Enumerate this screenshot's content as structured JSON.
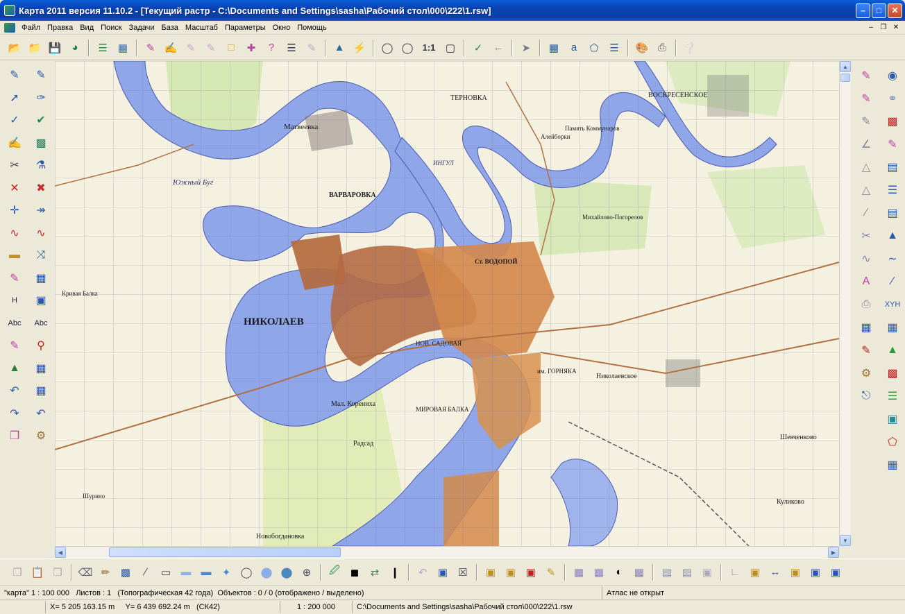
{
  "window": {
    "title": "Карта 2011 версия 11.10.2 - [Текущий растр - C:\\Documents and Settings\\sasha\\Рабочий стол\\000\\222\\1.rsw]"
  },
  "menu": {
    "items": [
      "Файл",
      "Правка",
      "Вид",
      "Поиск",
      "Задачи",
      "База",
      "Масштаб",
      "Параметры",
      "Окно",
      "Помощь"
    ]
  },
  "toolbar": {
    "scale_1_1": "1:1"
  },
  "left_panel": {
    "h_label": "H",
    "abc1": "Abc",
    "abc2": "Abc"
  },
  "right_panel": {
    "xyh_label": "XYH"
  },
  "map_labels": {
    "nikolaev": "НИКОЛАЕВ",
    "matveevka": "Матвеевка",
    "varvarovka": "ВАРВАРОВКА",
    "ternovka": "ТЕРНОВКА",
    "yuzhny_bug": "Южный Буг",
    "vodopoi": "Ст. ВОДОПОЙ",
    "nikolaevskoe": "Николаевское",
    "korenikha": "Мал. Корениха",
    "radsad": "Радсад",
    "shevchenkovo": "Шевченково",
    "pamyat": "Память Коммунаров",
    "voskresenskoe": "ВОСКРЕСЕНСКОЕ",
    "novobogdanovka": "Новобогдановка",
    "kulikovo": "Куликово",
    "shurino": "Шурино",
    "krivaya_balka": "Кривая Балка",
    "ingul": "ИНГУЛ",
    "sadovaya": "НОВ. САДОВАЯ",
    "mirovaya": "МИРОВАЯ БАЛКА",
    "gornyak": "им. ГОРНЯКА",
    "mikhailovo": "Михайлово-Погорелов",
    "alyaborki": "Алейборки"
  },
  "status": {
    "map_name": "\"карта\"",
    "scale": "1 : 100 000",
    "sheets": "Листов : 1",
    "projection": "(Топографическая 42 года)",
    "objects": "Объектов : 0 / 0 (отображено / выделено)",
    "atlas": "Атлас не открыт",
    "coord_x": "X= 5 205 163.15 m",
    "coord_y": "Y= 6 439 692.24 m",
    "system": "(СК42)",
    "raster_scale": "1 : 200 000",
    "raster_path": "C:\\Documents and Settings\\sasha\\Рабочий стол\\000\\222\\1.rsw"
  }
}
